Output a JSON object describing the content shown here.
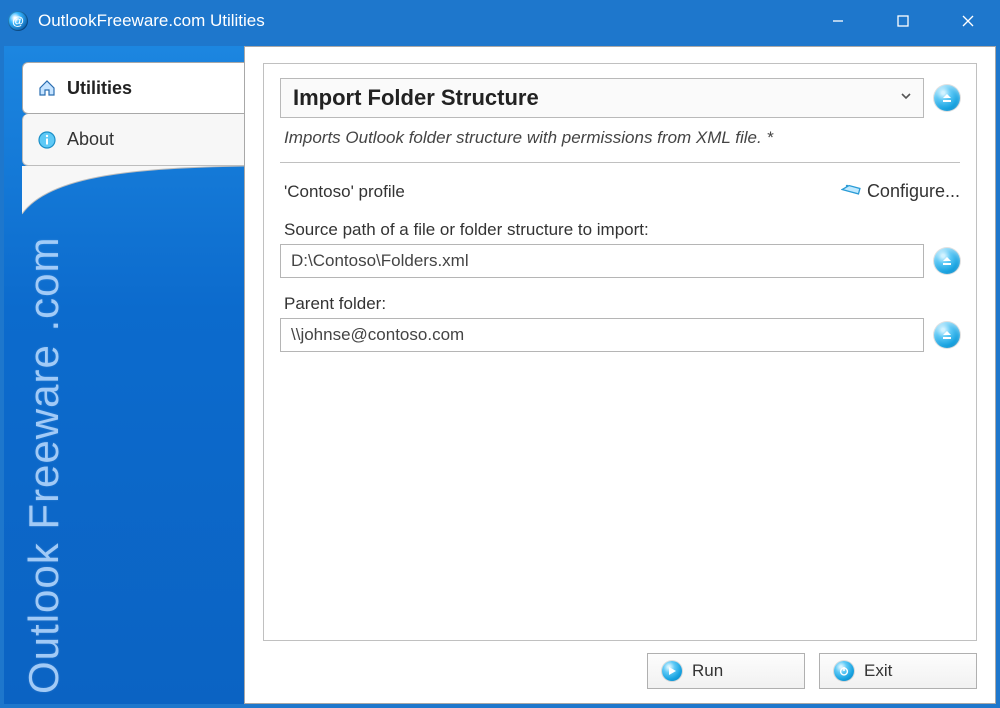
{
  "window": {
    "title": "OutlookFreeware.com Utilities"
  },
  "sidebar": {
    "tabs": [
      {
        "label": "Utilities"
      },
      {
        "label": "About"
      }
    ],
    "brand": "Outlook Freeware .com"
  },
  "main": {
    "dropdown_label": "Import Folder Structure",
    "description": "Imports Outlook folder structure with permissions from XML file. *",
    "profile_label": "'Contoso' profile",
    "configure_label": "Configure...",
    "source_label": "Source path of a file or folder structure to import:",
    "source_value": "D:\\Contoso\\Folders.xml",
    "parent_label": "Parent folder:",
    "parent_value": "\\\\johnse@contoso.com"
  },
  "buttons": {
    "run": "Run",
    "exit": "Exit"
  }
}
